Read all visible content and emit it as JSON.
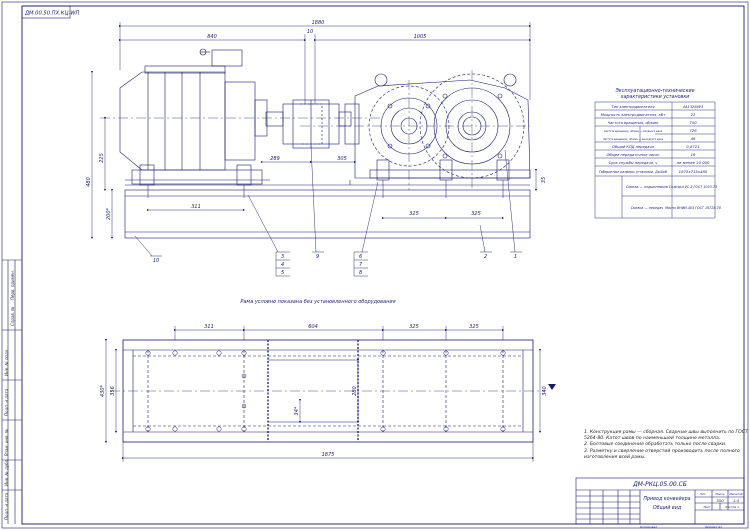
{
  "stamp_code": "ДМ-РКЦ.05.00.СБ",
  "corner_code": "ДМ.00.50.ПХ.КЦ-WП",
  "title_line1": "Привод конвейера",
  "title_line2": "Общий вид",
  "scale": "1:4",
  "sheet_label": "Лит.",
  "mass_label": "Масса",
  "scale_label": "Масштаб",
  "mass_value": "350",
  "sheet_text": "Лист",
  "sheets_text": "Листов 1",
  "copied": "Копировал",
  "format": "Формат А1",
  "table_title_1": "Эксплуатационно-технические",
  "table_title_2": "характеристики установки",
  "table_header": [
    "Тип электродвигателя",
    "4A132S6У3"
  ],
  "table_rows": [
    {
      "label": "Мощность электродвигателя, кВт",
      "value": "22"
    },
    {
      "label": "Частота вращения, об/мин",
      "value": "750"
    },
    {
      "label": "Частота вращения, об/мин — входного вала",
      "value": "726"
    },
    {
      "label": "Частота вращения, об/мин — выходного вала",
      "value": "46"
    },
    {
      "label": "Общий КПД передачи",
      "value": "0,8721"
    },
    {
      "label": "Общее передаточное число",
      "value": "16"
    },
    {
      "label": "Срок службы передачи, ч",
      "value": "не менее 10 000"
    },
    {
      "label": "Габаритные размеры установки, ДхШхВ",
      "value": "1875х715х480"
    },
    {
      "label": "Смазка — подшипников",
      "value": "Солидол УС-2 ГОСТ 1033-73"
    },
    {
      "label": "Смазка — передач",
      "value": "Масло ВНИИ-403 ГОСТ 16728-78"
    }
  ],
  "notes": [
    "1. Конструкция рамы — сборная. Сварные швы выполнить по ГОСТ",
    "5264-80. Катет швов по наименьшей толщине металла.",
    "2. Болтовые соединения обработать только после сварки.",
    "3. Разметку и сверление отверстий производить после полного",
    "изготовления всей рамы."
  ],
  "frame_caption": "Рама условно показана без установленного оборудования",
  "dims_top": {
    "overall": "1880",
    "motor": "840",
    "gap": "10",
    "reducer": "1005",
    "coupling": "289",
    "hub": "305",
    "shaft_h": "225",
    "height": "480",
    "frame_h": "200*",
    "left_bolts": "311",
    "rb1": "325",
    "rb2": "325",
    "r_h": "35"
  },
  "dims_plan": {
    "d1": "311",
    "d2": "604",
    "d3": "325",
    "d4": "325",
    "width": "430*",
    "inner": "356",
    "mid": "280",
    "small": "34*",
    "right": "340",
    "total": "1875"
  },
  "callouts": [
    "1",
    "2",
    "3",
    "4",
    "5",
    "6",
    "7",
    "8",
    "9",
    "10"
  ],
  "side_labels": [
    "Подп. и дата",
    "Инв. № дубл.",
    "Взам. инв. №",
    "Подп. и дата",
    "Инв. № подл.",
    "Справ. №",
    "Перв. примен."
  ]
}
